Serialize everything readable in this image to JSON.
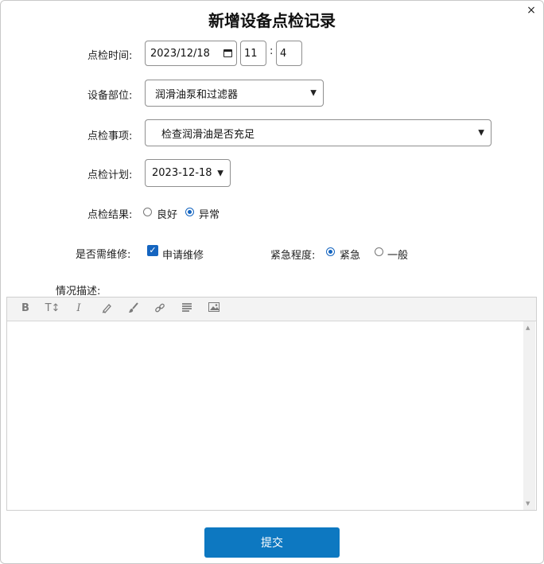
{
  "dialog": {
    "title": "新增设备点检记录",
    "close": "×"
  },
  "time": {
    "label": "点检时间:",
    "date": "2023/12/18",
    "hour": "11",
    "separator": ":",
    "minute": "4"
  },
  "part": {
    "label": "设备部位:",
    "value": "润滑油泵和过滤器"
  },
  "item": {
    "label": "点检事项:",
    "value": "检查润滑油是否充足"
  },
  "plan": {
    "label": "点检计划:",
    "value": "2023-12-18"
  },
  "result": {
    "label": "点检结果:",
    "options": [
      "良好",
      "异常"
    ],
    "selected": "异常"
  },
  "repair": {
    "label": "是否需维修:",
    "checkbox_label": "申请维修",
    "checked": true
  },
  "urgency": {
    "label": "紧急程度:",
    "options": [
      "紧急",
      "一般"
    ],
    "selected": "紧急"
  },
  "description": {
    "label": "情况描述:"
  },
  "toolbar": {
    "bold_glyph": "B",
    "text_size_glyph": "T↕",
    "italic_glyph": "I",
    "icons": [
      "bold-icon",
      "text-size-icon",
      "italic-icon",
      "highlight-pen-icon",
      "brush-icon",
      "link-icon",
      "align-icon",
      "image-icon"
    ]
  },
  "submit": {
    "label": "提交"
  },
  "colors": {
    "accent": "#0d78c1",
    "radio_checked": "#1565c0"
  }
}
